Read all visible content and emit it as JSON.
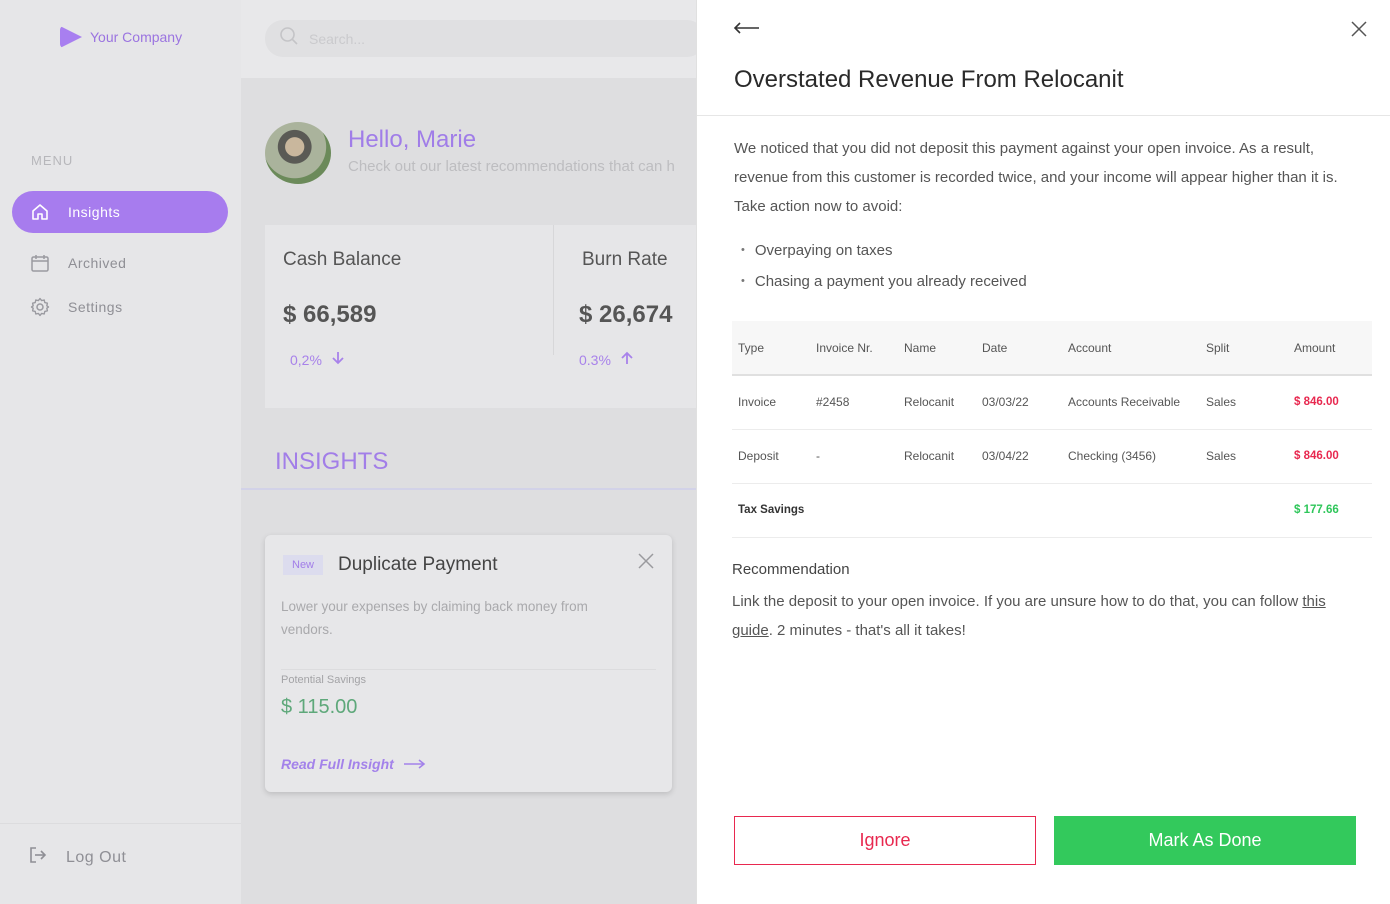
{
  "company": {
    "name": "Your Company"
  },
  "search": {
    "placeholder": "Search..."
  },
  "sidebar": {
    "menu_label": "MENU",
    "items": [
      {
        "label": "Insights",
        "icon": "home-icon",
        "active": true
      },
      {
        "label": "Archived",
        "icon": "calendar-icon",
        "active": false
      },
      {
        "label": "Settings",
        "icon": "gear-icon",
        "active": false
      }
    ],
    "logout_label": "Log Out"
  },
  "greeting": {
    "title": "Hello, Marie",
    "subtitle": "Check out our latest recommendations that can h"
  },
  "stats": [
    {
      "title": "Cash Balance",
      "value": "$ 66,589",
      "change": "0,2%",
      "direction": "down"
    },
    {
      "title": "Burn Rate",
      "value": "$ 26,674",
      "change": "0.3%",
      "direction": "up"
    }
  ],
  "insights": {
    "heading": "INSIGHTS",
    "card": {
      "badge": "New",
      "title": "Duplicate Payment",
      "description": "Lower your expenses by claiming back money from vendors.",
      "savings_label": "Potential Savings",
      "savings_value": "$ 115.00",
      "link_label": "Read Full Insight"
    }
  },
  "drawer": {
    "title": "Overstated Revenue From Relocanit",
    "intro": "We noticed that you did not deposit this payment against your open invoice. As a result, revenue from this customer is recorded twice, and your income will appear higher than it is. Take action now to avoid:",
    "bullets": [
      "Overpaying on taxes",
      "Chasing a payment you already received"
    ],
    "table": {
      "headers": [
        "Type",
        "Invoice Nr.",
        "Name",
        "Date",
        "Account",
        "Split",
        "Amount"
      ],
      "rows": [
        [
          "Invoice",
          "#2458",
          "Relocanit",
          "03/03/22",
          "Accounts Receivable",
          "Sales",
          "$ 846.00"
        ],
        [
          "Deposit",
          "-",
          "Relocanit",
          "03/04/22",
          "Checking (3456)",
          "Sales",
          "$ 846.00"
        ]
      ],
      "summary_label": "Tax Savings",
      "summary_value": "$ 177.66"
    },
    "recommendation": {
      "heading": "Recommendation",
      "text_before": "Link the deposit to your open invoice. If you are unsure how to do that, you can follow ",
      "link": "this guide",
      "text_after": ". 2 minutes - that's all it takes!"
    },
    "buttons": {
      "ignore": "Ignore",
      "done": "Mark As Done"
    }
  },
  "colors": {
    "accent": "#a77cee",
    "danger": "#e8284f",
    "success": "#33c95c"
  }
}
